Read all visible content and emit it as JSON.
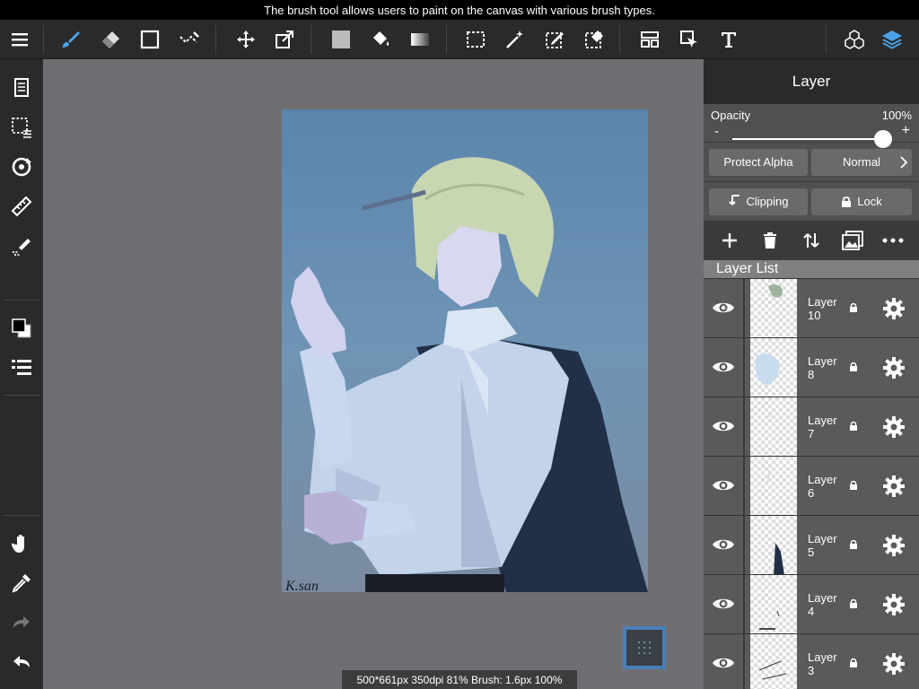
{
  "tooltip": "The brush tool allows users to paint on the canvas with various brush types.",
  "toolbar": {
    "tools": [
      "menu-icon",
      "brush-icon",
      "eraser-icon",
      "shape-icon",
      "curve-icon",
      "move-icon",
      "transform-icon",
      "fill-color-icon",
      "bucket-icon",
      "gradient-icon",
      "select-rect-icon",
      "magic-wand-icon",
      "select-pen-icon",
      "select-eraser-icon",
      "layout-icon",
      "select-layer-icon",
      "text-icon",
      "materials-icon",
      "layers-icon"
    ],
    "active_tool": "brush-icon",
    "accent": "#4aa3e8"
  },
  "sidebar": {
    "items": [
      "pages-icon",
      "selection-icon",
      "rotate-icon",
      "ruler-icon",
      "snap-icon",
      "color-swatch-icon",
      "layer-list-icon",
      "hand-icon",
      "eyedropper-icon",
      "redo-icon",
      "undo-icon"
    ]
  },
  "canvas": {
    "signature": "K.san",
    "status": "500*661px 350dpi 81% Brush: 1.6px 100%"
  },
  "layer_panel": {
    "title": "Layer",
    "opacity_label": "Opacity",
    "opacity_value": "100%",
    "opacity_fraction": 1.0,
    "minus": "-",
    "plus": "+",
    "protect_alpha": "Protect Alpha",
    "blend_mode": "Normal",
    "clipping": "Clipping",
    "lock": "Lock",
    "layer_list_title": "Layer List",
    "layers": [
      {
        "name": "Layer 10"
      },
      {
        "name": "Layer 8"
      },
      {
        "name": "Layer 7"
      },
      {
        "name": "Layer 6"
      },
      {
        "name": "Layer 5"
      },
      {
        "name": "Layer 4"
      },
      {
        "name": "Layer 3"
      }
    ]
  }
}
